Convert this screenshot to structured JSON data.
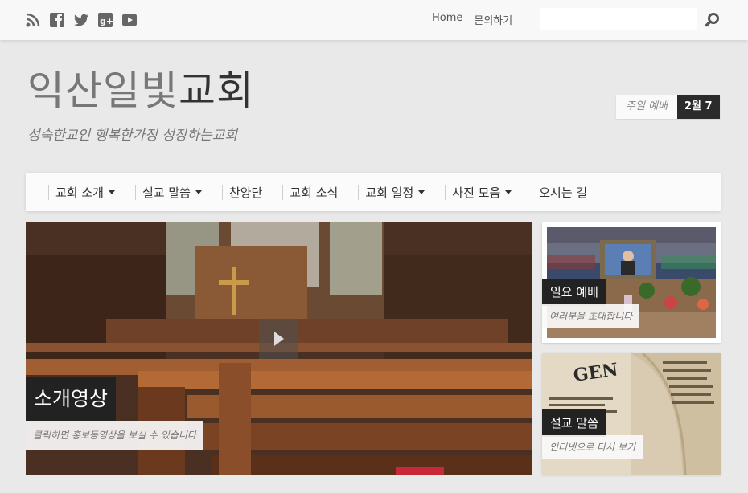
{
  "social_icons": [
    "rss-icon",
    "facebook-icon",
    "twitter-icon",
    "google-plus-icon",
    "youtube-icon"
  ],
  "topnav": {
    "home": "Home",
    "contact": "문의하기"
  },
  "search": {
    "placeholder": ""
  },
  "site": {
    "title_part1": "익산일빛",
    "title_part2": "교회",
    "tagline": "성숙한교인 행복한가정 성장하는교회"
  },
  "event": {
    "label": "주일 예배",
    "date": "2월 7"
  },
  "mainnav": {
    "items": [
      {
        "label": "교회 소개",
        "has_dropdown": true
      },
      {
        "label": "설교 말씀",
        "has_dropdown": true
      },
      {
        "label": "찬양단",
        "has_dropdown": false
      },
      {
        "label": "교회 소식",
        "has_dropdown": false
      },
      {
        "label": "교회 일정",
        "has_dropdown": true
      },
      {
        "label": "사진 모음",
        "has_dropdown": true
      },
      {
        "label": "오시는 길",
        "has_dropdown": false
      }
    ]
  },
  "hero": {
    "title": "소개영상",
    "subtitle": "클릭하면 홍보동영상을 보실 수 있습니다"
  },
  "cards": [
    {
      "title": "일요 예배",
      "subtitle": "여러분을 초대합니다"
    },
    {
      "title": "설교 말씀",
      "subtitle": "인터넷으로 다시 보기"
    }
  ],
  "colors": {
    "accent_dark": "#222222",
    "background": "#e9e9e9"
  }
}
